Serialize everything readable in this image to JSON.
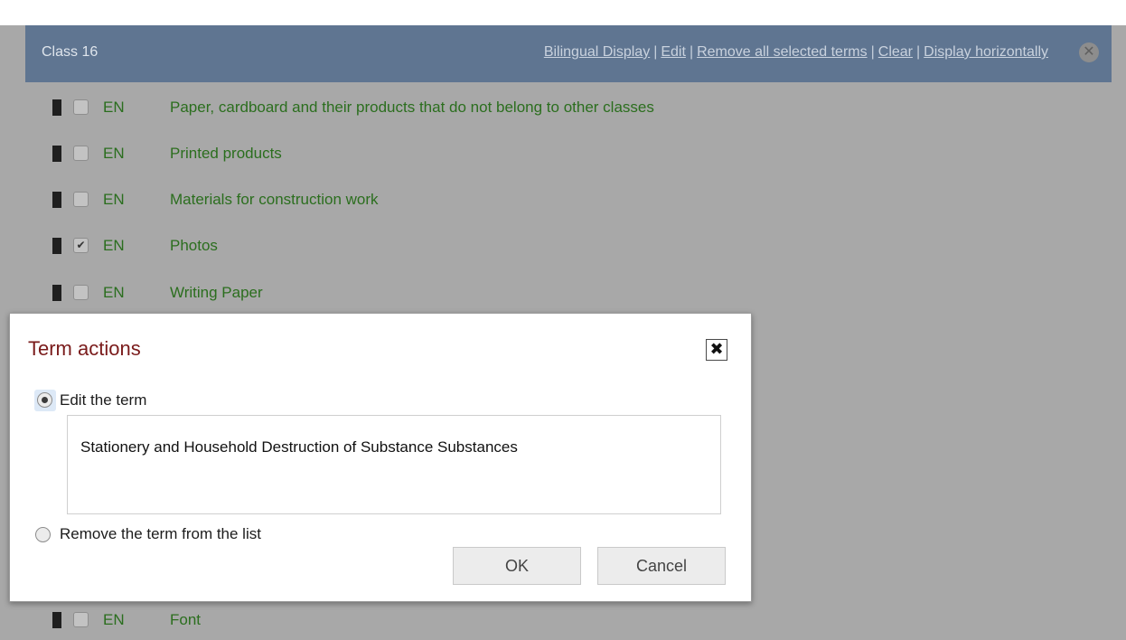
{
  "panel": {
    "class_title": "Class 16",
    "actions": [
      {
        "label": "Bilingual Display"
      },
      {
        "label": "Edit"
      },
      {
        "label": "Remove all selected terms"
      },
      {
        "label": "Clear"
      },
      {
        "label": "Display horizontally"
      }
    ],
    "separator": "|",
    "close_icon": "close-circle-icon"
  },
  "terms": [
    {
      "lang": "EN",
      "text": "Paper, cardboard and their products that do not belong to other classes",
      "checked": false
    },
    {
      "lang": "EN",
      "text": "Printed products",
      "checked": false
    },
    {
      "lang": "EN",
      "text": "Materials for construction work",
      "checked": false
    },
    {
      "lang": "EN",
      "text": "Photos",
      "checked": true
    },
    {
      "lang": "EN",
      "text": "Writing Paper",
      "checked": false
    },
    {
      "lang": "EN",
      "text": "Font",
      "checked": false
    }
  ],
  "colors": {
    "header_bg": "#5f7591",
    "term_text": "#2b6e1e",
    "modal_title": "#7a1b1b",
    "overlay": "#a8a8a8"
  },
  "modal": {
    "title": "Term actions",
    "close_icon": "close-x-icon",
    "options": {
      "edit_label": "Edit the term",
      "remove_label": "Remove the term from the list",
      "selected": "edit"
    },
    "term_value": "Stationery and Household Destruction of Substance Substances",
    "ok_label": "OK",
    "cancel_label": "Cancel"
  }
}
